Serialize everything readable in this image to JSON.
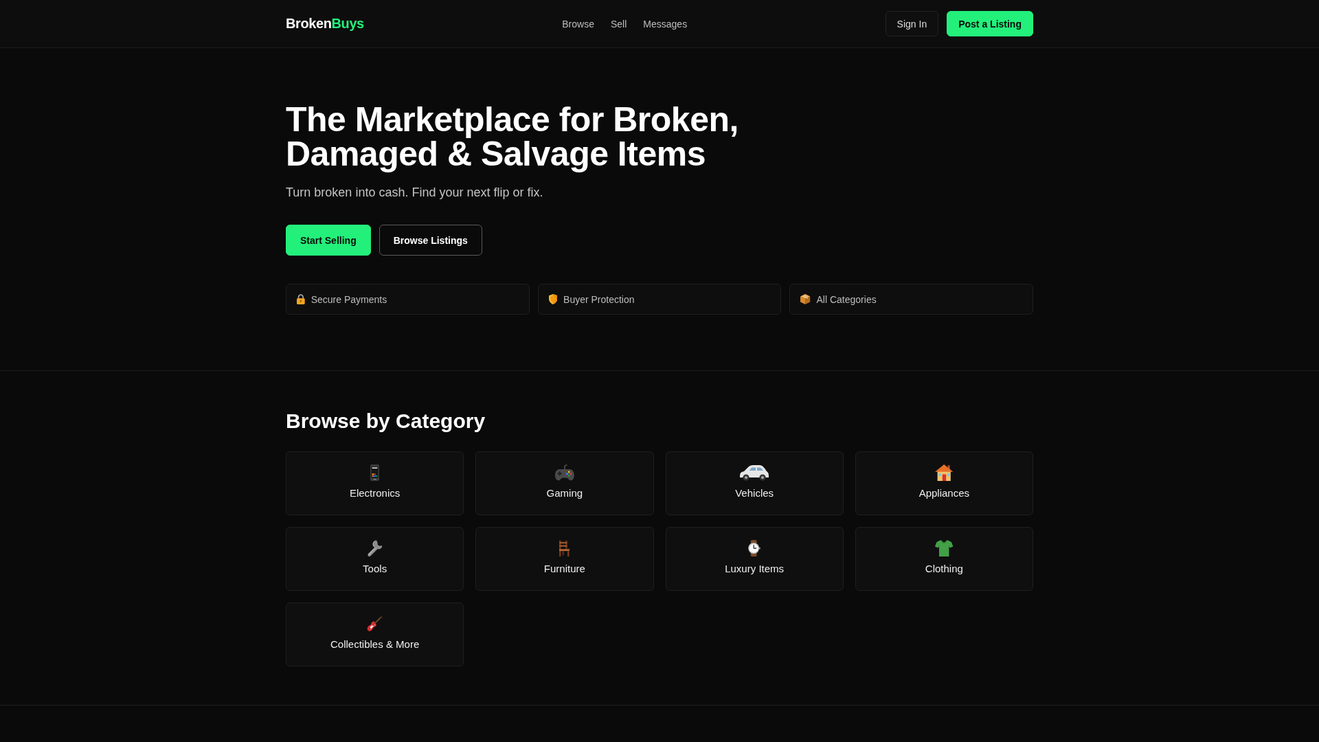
{
  "header": {
    "logo": {
      "name": "Broken",
      "accent": "Buys"
    },
    "nav": [
      "Browse",
      "Sell",
      "Messages"
    ],
    "actions": [
      {
        "label": "Sign In",
        "kind": "ghost"
      },
      {
        "label": "Post a Listing",
        "kind": "primary"
      }
    ]
  },
  "hero": {
    "title": "The Marketplace for Broken, Damaged & Salvage Items",
    "subtitle": "Turn broken into cash. Find your next flip or fix.",
    "buttons": [
      {
        "label": "Start Selling",
        "kind": "primary"
      },
      {
        "label": "Browse Listings",
        "kind": "outline"
      }
    ],
    "features": [
      "Secure Payments",
      "Buyer Protection",
      "All Categories"
    ]
  },
  "categories": {
    "title": "Browse by Category",
    "items": [
      "Electronics",
      "Gaming",
      "Vehicles",
      "Appliances",
      "Tools",
      "Furniture",
      "Luxury Items",
      "Clothing",
      "Collectibles & More"
    ]
  }
}
